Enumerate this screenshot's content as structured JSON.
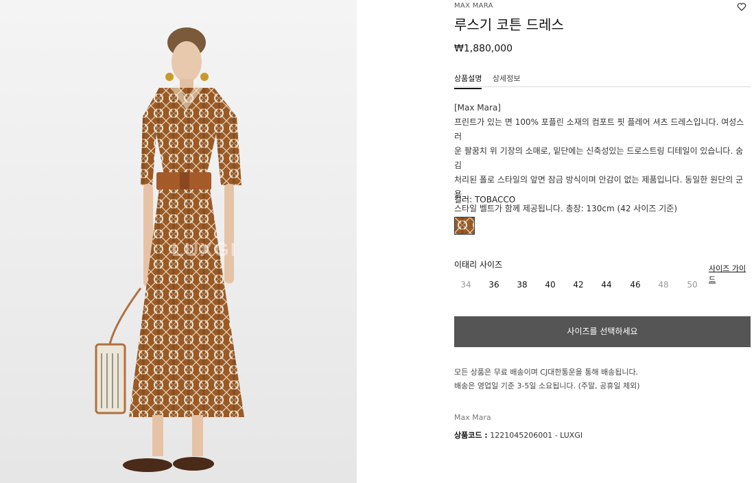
{
  "product": {
    "brand": "MAX MARA",
    "title": "루스기 코튼 드레스",
    "price": "₩1,880,000",
    "image_watermark": "LUXGI"
  },
  "tabs": [
    {
      "label": "상품설명",
      "active": true
    },
    {
      "label": "상세정보",
      "active": false
    }
  ],
  "description": {
    "brand_tag": "[Max Mara]",
    "lines": [
      "프린트가 있는 면 100% 포플린 소재의 컴포트 핏 플레어 셔츠 드레스입니다. 여성스러",
      "운 팔꿈치 위 기장의 소매로, 밑단에는 신축성있는 드로스트링 디테일이 있습니다. 숨김",
      "처리된 폴로 스타일의 앞면 잠금 방식이며 안감이 없는 제품입니다. 동일한 원단의 군용",
      "스타일 벨트가 함께 제공됩니다. 총장: 130cm (42 사이즈 기준)"
    ]
  },
  "color": {
    "label": "컬러:",
    "value": "TOBACCO",
    "swatch_color": "#8b5a2b"
  },
  "size": {
    "label": "이태리 사이즈",
    "guide_label": "사이즈 가이드",
    "options": [
      {
        "value": "34",
        "available": false
      },
      {
        "value": "36",
        "available": true
      },
      {
        "value": "38",
        "available": true
      },
      {
        "value": "40",
        "available": true
      },
      {
        "value": "42",
        "available": true
      },
      {
        "value": "44",
        "available": true
      },
      {
        "value": "46",
        "available": true
      },
      {
        "value": "48",
        "available": false
      },
      {
        "value": "50",
        "available": false
      }
    ]
  },
  "cta": {
    "label": "사이즈를 선택하세요",
    "color": "#555555"
  },
  "shipping": {
    "line1": "모든 상품은 무료 배송이며 CJ대한통운을 통해 배송됩니다.",
    "line2": "배송은 영업일 기준 3-5일 소요됩니다. (주말, 공휴일 제외)"
  },
  "meta": {
    "maker": "Max Mara",
    "code_label": "상품코드 :",
    "code_value": "1221045206001 - LUXGI"
  }
}
